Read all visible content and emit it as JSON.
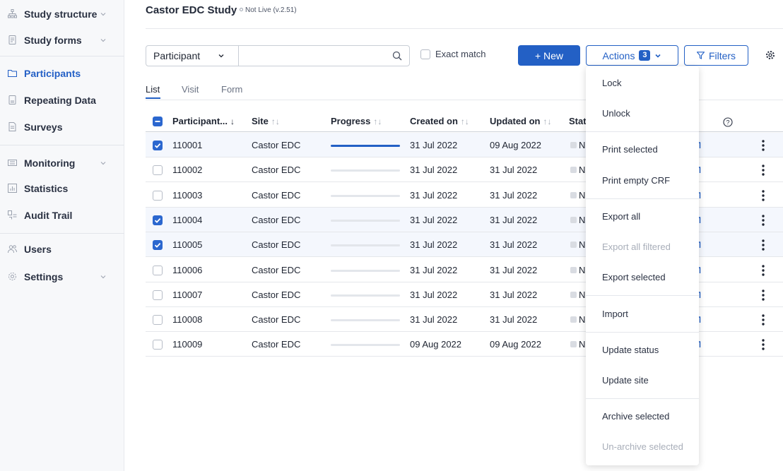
{
  "sidebar": {
    "items": [
      {
        "label": "Study structure",
        "icon": "sitemap-icon",
        "has_chevron": true
      },
      {
        "label": "Study forms",
        "icon": "form-icon",
        "has_chevron": true
      },
      {
        "label": "Participants",
        "icon": "folder-icon",
        "has_chevron": false,
        "active": true
      },
      {
        "label": "Repeating Data",
        "icon": "document-icon",
        "has_chevron": false
      },
      {
        "label": "Surveys",
        "icon": "survey-icon",
        "has_chevron": false
      },
      {
        "label": "Monitoring",
        "icon": "monitoring-icon",
        "has_chevron": true
      },
      {
        "label": "Statistics",
        "icon": "bar-chart-icon",
        "has_chevron": false
      },
      {
        "label": "Audit Trail",
        "icon": "audit-icon",
        "has_chevron": false
      },
      {
        "label": "Users",
        "icon": "users-icon",
        "has_chevron": false
      },
      {
        "label": "Settings",
        "icon": "gear-icon",
        "has_chevron": true
      }
    ]
  },
  "header": {
    "study_title": "Castor EDC Study",
    "study_status": "Not Live (v.2.51)"
  },
  "toolbar": {
    "search_field": "Participant",
    "search_value": "",
    "exact_match_label": "Exact match",
    "new_label": "+ New",
    "actions_label": "Actions",
    "actions_count": "3",
    "filters_label": "Filters"
  },
  "tabs": [
    {
      "label": "List",
      "active": true
    },
    {
      "label": "Visit",
      "active": false
    },
    {
      "label": "Form",
      "active": false
    }
  ],
  "table": {
    "columns": {
      "participant": "Participant...",
      "participant_sort": "↓",
      "site": "Site",
      "progress": "Progress",
      "created": "Created on",
      "updated": "Updated on",
      "status": "Stat",
      "sort_icon": "↑↓"
    },
    "rows": [
      {
        "id": "110001",
        "site": "Castor EDC",
        "progress": 1.0,
        "created": "31 Jul 2022",
        "updated": "09 Aug 2022",
        "status": "N",
        "selected": true
      },
      {
        "id": "110002",
        "site": "Castor EDC",
        "progress": 0.0,
        "created": "31 Jul 2022",
        "updated": "31 Jul 2022",
        "status": "N",
        "selected": false
      },
      {
        "id": "110003",
        "site": "Castor EDC",
        "progress": 0.0,
        "created": "31 Jul 2022",
        "updated": "31 Jul 2022",
        "status": "N",
        "selected": false
      },
      {
        "id": "110004",
        "site": "Castor EDC",
        "progress": 0.0,
        "created": "31 Jul 2022",
        "updated": "31 Jul 2022",
        "status": "N",
        "selected": true
      },
      {
        "id": "110005",
        "site": "Castor EDC",
        "progress": 0.0,
        "created": "31 Jul 2022",
        "updated": "31 Jul 2022",
        "status": "N",
        "selected": true
      },
      {
        "id": "110006",
        "site": "Castor EDC",
        "progress": 0.0,
        "created": "31 Jul 2022",
        "updated": "31 Jul 2022",
        "status": "N",
        "selected": false
      },
      {
        "id": "110007",
        "site": "Castor EDC",
        "progress": 0.0,
        "created": "31 Jul 2022",
        "updated": "31 Jul 2022",
        "status": "N",
        "selected": false
      },
      {
        "id": "110008",
        "site": "Castor EDC",
        "progress": 0.0,
        "created": "31 Jul 2022",
        "updated": "31 Jul 2022",
        "status": "N",
        "selected": false
      },
      {
        "id": "110009",
        "site": "Castor EDC",
        "progress": 0.0,
        "created": "09 Aug 2022",
        "updated": "09 Aug 2022",
        "status": "N",
        "selected": false
      }
    ]
  },
  "actions_menu": {
    "items": [
      {
        "label": "Lock",
        "disabled": false
      },
      {
        "label": "Unlock",
        "disabled": false
      },
      {
        "label": "Print selected",
        "disabled": false
      },
      {
        "label": "Print empty CRF",
        "disabled": false
      },
      {
        "label": "Export all",
        "disabled": false
      },
      {
        "label": "Export all filtered",
        "disabled": true
      },
      {
        "label": "Export selected",
        "disabled": false
      },
      {
        "label": "Import",
        "disabled": false
      },
      {
        "label": "Update status",
        "disabled": false
      },
      {
        "label": "Update site",
        "disabled": false
      },
      {
        "label": "Archive selected",
        "disabled": false
      },
      {
        "label": "Un-archive selected",
        "disabled": true
      }
    ]
  },
  "colors": {
    "accent": "#2360c5",
    "sidebar_bg": "#f7f8fa",
    "selected_row": "#f4f7fd"
  }
}
